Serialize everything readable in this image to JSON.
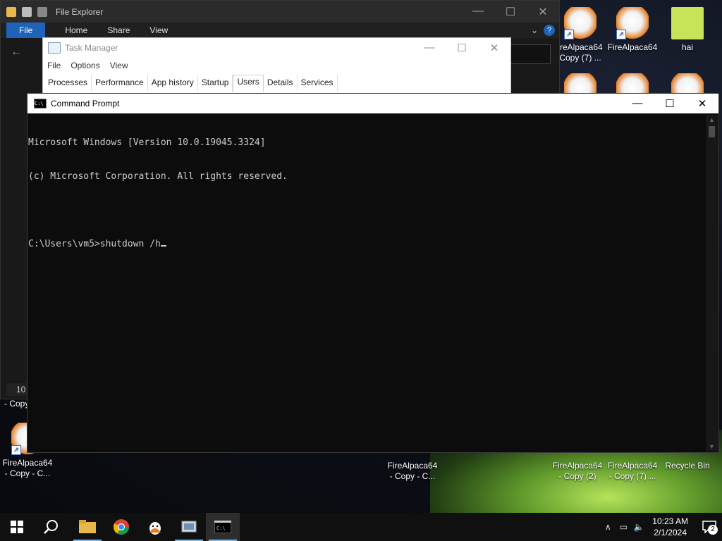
{
  "explorer": {
    "title": "File Explorer",
    "ribbon_tabs": [
      "File",
      "Home",
      "Share",
      "View"
    ],
    "status_text": "10",
    "left_item_text": "- Copy",
    "help_label": "?"
  },
  "taskmgr": {
    "title": "Task Manager",
    "menu": [
      "File",
      "Options",
      "View"
    ],
    "tabs": [
      "Processes",
      "Performance",
      "App history",
      "Startup",
      "Users",
      "Details",
      "Services"
    ],
    "active_tab": "Users"
  },
  "cmd": {
    "title": "Command Prompt",
    "lines": [
      "Microsoft Windows [Version 10.0.19045.3324]",
      "(c) Microsoft Corporation. All rights reserved.",
      "",
      "C:\\Users\\vm5>shutdown /h"
    ]
  },
  "desktop_icons": [
    {
      "label1": "ireAlpaca64",
      "label2": "Copy (7) ...",
      "icon": "firealpaca-icon"
    },
    {
      "label1": "FireAlpaca64",
      "label2": "",
      "icon": "firealpaca-icon"
    },
    {
      "label1": "hai",
      "label2": "",
      "icon": "hai-image-icon"
    },
    {
      "label1": "FireAlpaca64",
      "label2": "- Copy - C...",
      "icon": "firealpaca-icon"
    },
    {
      "label1": "FireAlpaca64",
      "label2": "- Copy - C...",
      "icon": "firealpaca-icon"
    },
    {
      "label1": "FireAlpaca64",
      "label2": "- Copy (2)",
      "icon": "firealpaca-icon"
    },
    {
      "label1": "FireAlpaca64",
      "label2": "- Copy (7) ...",
      "icon": "firealpaca-icon"
    },
    {
      "label1": "Recycle Bin",
      "label2": "",
      "icon": "recycle-bin-icon"
    }
  ],
  "taskbar": {
    "apps": [
      "start-icon",
      "search-icon",
      "file-explorer-icon",
      "chrome-icon",
      "firealpaca-icon",
      "control-panel-icon",
      "command-prompt-icon"
    ],
    "time": "10:23 AM",
    "date": "2/1/2024",
    "notification_count": "2"
  },
  "colors": {
    "accent": "#1e63b8",
    "cmd_bg": "#0c0c0c",
    "cmd_text": "#cccccc",
    "taskbar_bg": "#101010"
  }
}
